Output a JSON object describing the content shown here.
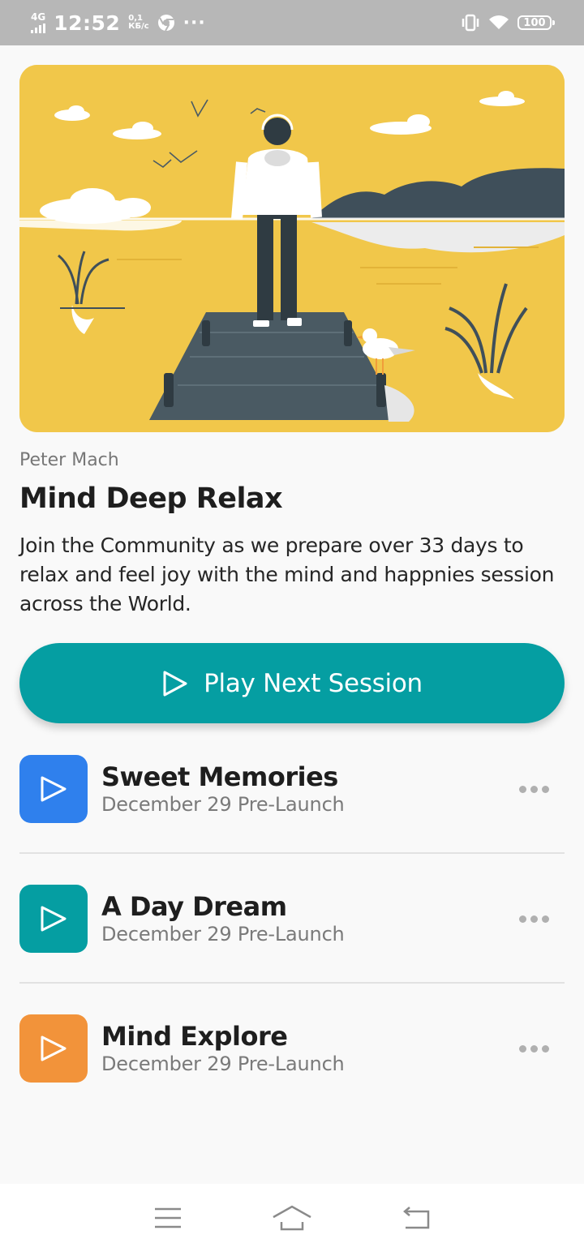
{
  "status_bar": {
    "network": "4G",
    "time": "12:52",
    "speed_value": "0,1",
    "speed_unit": "КБ/с",
    "more": "···",
    "battery": "100"
  },
  "hero": {
    "illustration": "person-on-pier-lake-illustration",
    "bg_color": "#f1c74a"
  },
  "course": {
    "author": "Peter Mach",
    "title": "Mind Deep Relax",
    "description": "Join the Community as we prepare over 33 days to relax and feel joy with the mind and happnies session across the World."
  },
  "play_button": {
    "label": "Play Next Session",
    "icon": "play-outline-icon",
    "color": "#059ea2"
  },
  "sessions": [
    {
      "title": "Sweet Memories",
      "subtitle": "December 29 Pre-Launch",
      "color": "#2f80ed",
      "icon": "play-icon",
      "more_icon": "more-horizontal-icon"
    },
    {
      "title": "A Day Dream",
      "subtitle": "December 29 Pre-Launch",
      "color": "#059ea2",
      "icon": "play-icon",
      "more_icon": "more-horizontal-icon"
    },
    {
      "title": "Mind Explore",
      "subtitle": "December 29 Pre-Launch",
      "color": "#f2933a",
      "icon": "play-icon",
      "more_icon": "more-horizontal-icon"
    }
  ],
  "nav_bar": {
    "items": [
      "menu-icon",
      "home-icon",
      "back-icon"
    ]
  }
}
